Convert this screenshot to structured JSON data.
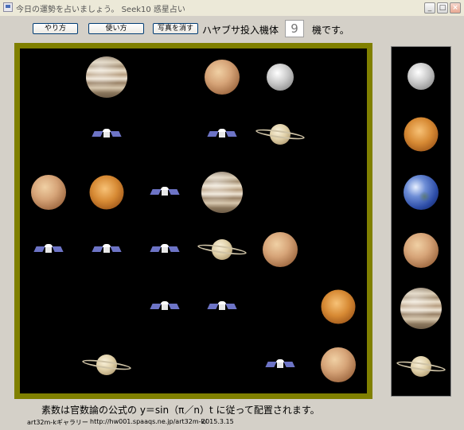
{
  "window": {
    "title": "今日の運勢を占いましょう。 Seek10 惑星占い",
    "minimize_glyph": "_",
    "maximize_glyph": "□",
    "close_glyph": "×"
  },
  "toolbar": {
    "howto_label": "やり方",
    "usage_label": "使い方",
    "clear_photos_label": "写真を消す",
    "count_prefix": "ハヤブサ投入機体",
    "count_value": "9",
    "count_suffix": "機です。"
  },
  "board": {
    "cells": [
      [
        "",
        "jupiter",
        "",
        "mars",
        "mercury",
        ""
      ],
      [
        "",
        "probe",
        "",
        "probe",
        "saturn",
        ""
      ],
      [
        "mars",
        "venus",
        "probe",
        "jupiter",
        "",
        ""
      ],
      [
        "probe",
        "probe",
        "probe",
        "saturn",
        "mars",
        ""
      ],
      [
        "",
        "",
        "probe",
        "probe",
        "",
        "venus"
      ],
      [
        "",
        "saturn",
        "",
        "",
        "probe",
        "mars"
      ]
    ]
  },
  "side_panel": {
    "planets": [
      "mercury",
      "venus",
      "earth",
      "mars",
      "jupiter",
      "saturn"
    ]
  },
  "caption": "素数は官数論の公式の y＝sin（π／n）t に従って配置されます。",
  "footer": {
    "author": "art32m-kギャラリー",
    "url": "http://hw001.spaaqs.ne.jp/art32m-k/",
    "date": "2015.3.15"
  }
}
